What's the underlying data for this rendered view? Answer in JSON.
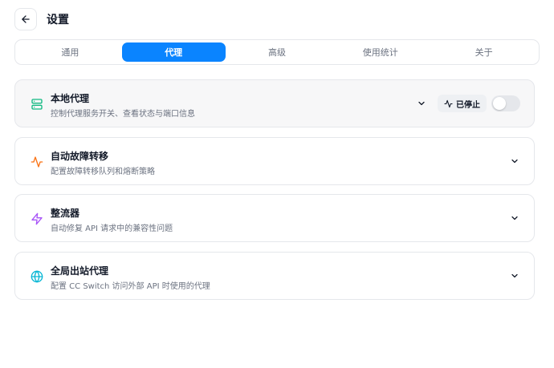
{
  "header": {
    "title": "设置",
    "back_icon": "arrow-left-icon"
  },
  "tabs": [
    {
      "label": "通用",
      "active": false
    },
    {
      "label": "代理",
      "active": true
    },
    {
      "label": "高级",
      "active": false
    },
    {
      "label": "使用统计",
      "active": false
    },
    {
      "label": "关于",
      "active": false
    }
  ],
  "colors": {
    "accent": "#0a84ff",
    "local_proxy_icon": "#10b981",
    "failover_icon": "#f97316",
    "rectifier_icon": "#a855f7",
    "global_proxy_icon": "#06b6d4"
  },
  "sections": [
    {
      "title": "本地代理",
      "description": "控制代理服务开关、查看状态与端口信息",
      "icon": "server-icon",
      "status": "已停止",
      "toggle_on": false
    },
    {
      "title": "自动故障转移",
      "description": "配置故障转移队列和熔断策略",
      "icon": "activity-icon"
    },
    {
      "title": "整流器",
      "description": "自动修复 API 请求中的兼容性问题",
      "icon": "zap-icon"
    },
    {
      "title": "全局出站代理",
      "description": "配置 CC Switch 访问外部 API 时使用的代理",
      "icon": "globe-icon"
    }
  ]
}
